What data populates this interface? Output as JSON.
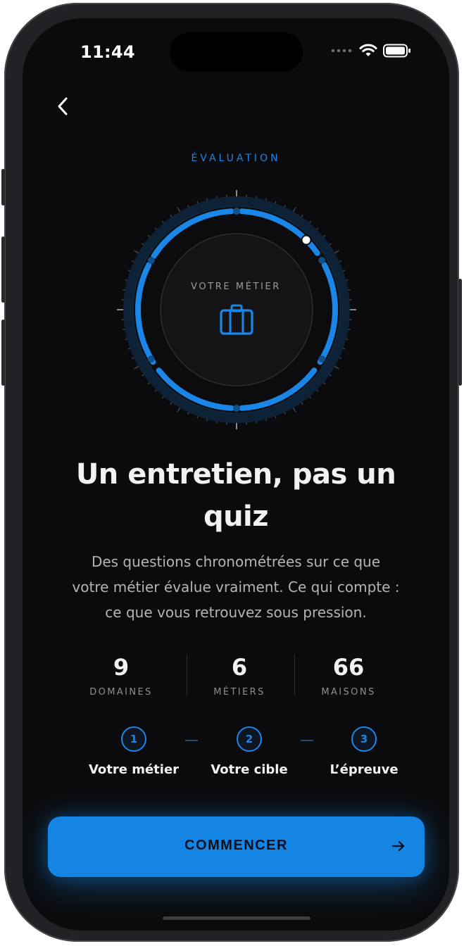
{
  "status_bar": {
    "time": "11:44",
    "icons": [
      "cellular-signal-icon",
      "wifi-icon",
      "battery-icon"
    ]
  },
  "nav": {
    "back_icon": "chevron-left-icon"
  },
  "eyebrow": "ÉVALUATION",
  "dial": {
    "label": "VOTRE MÉTIER",
    "icon": "briefcase-icon",
    "accent_color": "#1a86e8"
  },
  "hero": {
    "title_line1": "Un entretien, pas un",
    "title_line2": "quiz",
    "description_line1": "Des questions chronométrées sur ce que",
    "description_line2": "votre métier évalue vraiment. Ce qui compte :",
    "description_line3": "ce que vous retrouvez sous pression."
  },
  "stats": [
    {
      "value": "9",
      "label": "DOMAINES"
    },
    {
      "value": "6",
      "label": "MÉTIERS"
    },
    {
      "value": "66",
      "label": "MAISONS"
    }
  ],
  "steps": [
    {
      "number": "1",
      "label": "Votre métier"
    },
    {
      "number": "2",
      "label": "Votre cible"
    },
    {
      "number": "3",
      "label": "L’épreuve"
    }
  ],
  "cta": {
    "label": "COMMENCER",
    "icon": "arrow-right-icon"
  },
  "colors": {
    "accent": "#1485e3",
    "background": "#0b0b0d",
    "text": "#f2f2f4"
  }
}
